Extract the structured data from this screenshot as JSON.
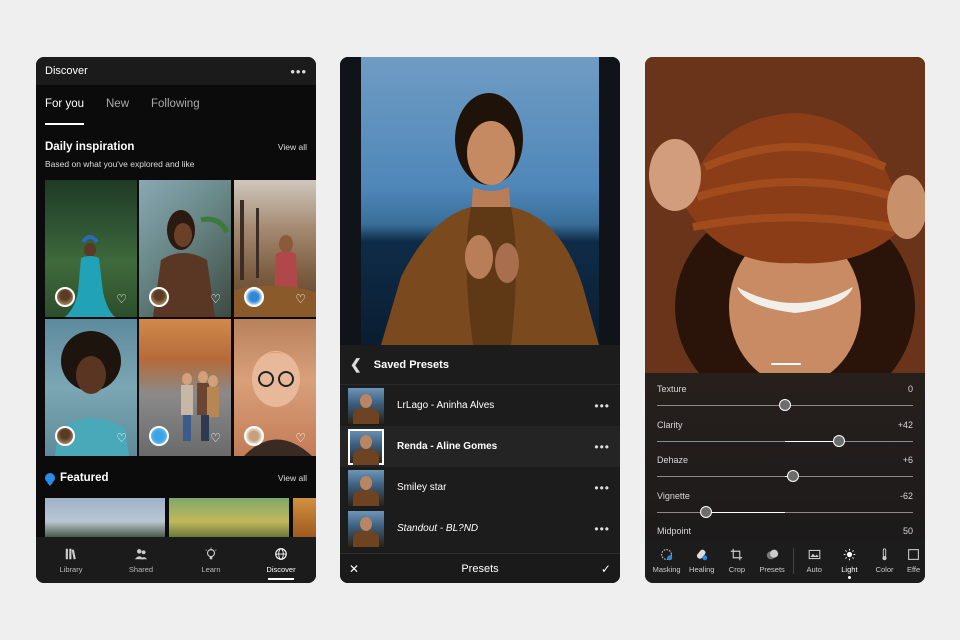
{
  "discover": {
    "title": "Discover",
    "tabs": [
      "For you",
      "New",
      "Following"
    ],
    "daily": {
      "title": "Daily inspiration",
      "subtitle": "Based on what you've explored and like",
      "view_all": "View all"
    },
    "featured": {
      "title": "Featured",
      "view_all": "View all"
    },
    "nav": [
      "Library",
      "Shared",
      "Learn",
      "Discover"
    ],
    "active_nav": "Discover"
  },
  "presets": {
    "header": "Saved Presets",
    "items": [
      {
        "name": "LrLago - Aninha Alves",
        "style": "normal"
      },
      {
        "name": "Renda - Aline Gomes",
        "style": "bold"
      },
      {
        "name": "Smiley star",
        "style": "normal"
      },
      {
        "name": "Standout - BL?ND",
        "style": "italic"
      }
    ],
    "footer_title": "Presets"
  },
  "edit": {
    "sliders": [
      {
        "label": "Texture",
        "value": "0",
        "position": 0.5
      },
      {
        "label": "Clarity",
        "value": "+42",
        "position": 0.71
      },
      {
        "label": "Dehaze",
        "value": "+6",
        "position": 0.53
      },
      {
        "label": "Vignette",
        "value": "-62",
        "position": 0.19
      },
      {
        "label": "Midpoint",
        "value": "50",
        "position": 0.5
      }
    ],
    "tools": [
      "Masking",
      "Healing",
      "Crop",
      "Presets",
      "Auto",
      "Light",
      "Color",
      "Effe"
    ],
    "active_tool": "Light"
  },
  "colors": {
    "accent_blue": "#2b8ce6",
    "panel": "#1c1c1c",
    "background": "#efefef"
  }
}
